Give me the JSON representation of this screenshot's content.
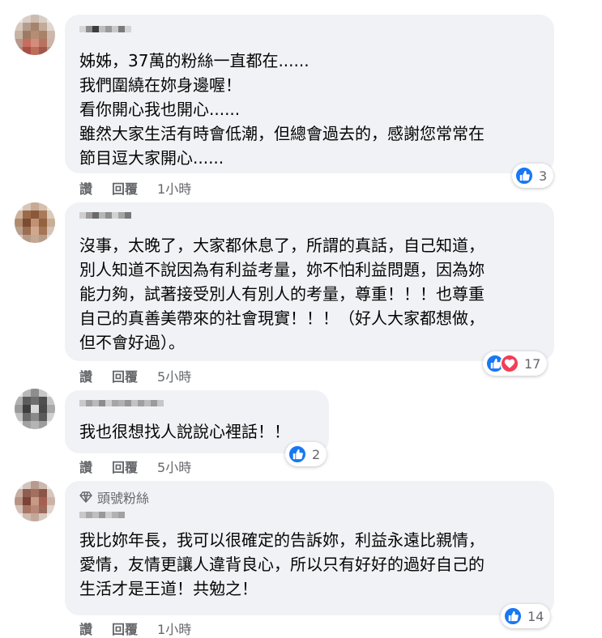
{
  "comments": [
    {
      "text": "姊姊，37萬的粉絲一直都在......\n我們圍繞在妳身邊喔！\n看你開心我也開心......\n雖然大家生活有時會低潮，但總會過去的，感謝您常常在\n節目逗大家開心......",
      "reaction_count": "3",
      "reactions": [
        "like"
      ],
      "time": "1小時"
    },
    {
      "text": "沒事，太晚了，大家都休息了，所謂的真話，自己知道，\n別人知道不說因為有利益考量，妳不怕利益問題，因為妳\n能力夠，試著接受別人有別人的考量，尊重！！！也尊重\n自己的真善美帶來的社會現實！！！（好人大家都想做，\n但不會好過）。",
      "reaction_count": "17",
      "reactions": [
        "like",
        "love"
      ],
      "time": "5小時"
    },
    {
      "text": "我也很想找人說說心裡話！！",
      "reaction_count": "2",
      "reactions": [
        "like"
      ],
      "time": "5小時"
    },
    {
      "badge": "頭號粉絲",
      "text": "我比妳年長，我可以很確定的告訴妳，利益永遠比親情，\n愛情，友情更讓人違背良心，所以只有好好的過好自己的\n生活才是王道！共勉之！",
      "reaction_count": "14",
      "reactions": [
        "like"
      ],
      "time": "1小時"
    }
  ],
  "actions": {
    "like_label": "讚",
    "reply_label": "回覆"
  },
  "colors": {
    "bubble": "#f0f2f5",
    "meta_text": "#65676b",
    "like": "#1877f2",
    "love": "#f33e58"
  }
}
